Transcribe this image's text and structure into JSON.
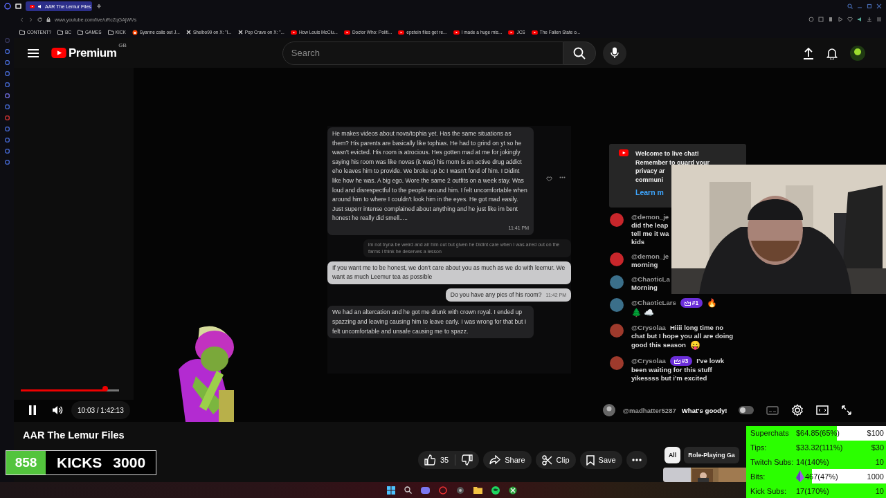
{
  "browser": {
    "tab": {
      "title": "AAR The Lemur Files"
    },
    "address": "www.youtube.com/live/uRcZqGAjWVs",
    "bookmarks": [
      {
        "label": "CONTENT?",
        "kind": "folder"
      },
      {
        "label": "BC",
        "kind": "folder"
      },
      {
        "label": "GAMES",
        "kind": "folder"
      },
      {
        "label": "KICK",
        "kind": "folder"
      },
      {
        "label": "Syanne calls out J...",
        "kind": "reddit"
      },
      {
        "label": "Shelbo99 on X: \"I...",
        "kind": "x"
      },
      {
        "label": "Pop Crave on X: \"...",
        "kind": "x"
      },
      {
        "label": "How Louis McClu...",
        "kind": "youtube"
      },
      {
        "label": "Doctor Who: Politi...",
        "kind": "youtube"
      },
      {
        "label": "epstein files get re...",
        "kind": "youtube"
      },
      {
        "label": "I made a huge mis...",
        "kind": "youtube"
      },
      {
        "label": "JCS",
        "kind": "youtube"
      },
      {
        "label": "The Fallen State o...",
        "kind": "youtube"
      }
    ]
  },
  "header": {
    "logo": "Premium",
    "region": "GB",
    "search": {
      "placeholder": "Search"
    }
  },
  "video": {
    "messages": [
      {
        "kind": "received",
        "text": "He makes videos about nova/tophia yet. Has the same situations as them? His parents are basically like tophias. He had to grind on yt so he wasn't evicted. His room is atrocious. Hes gotten mad at me for jokingly saying his room was like novas (it was) his mom is an active drug addict eho leaves him to provide. We broke up bc I wasn't fond of him. I Didint like how he was. A big ego. Wore the same 2 outfits on a week stay. Was loud and disrespectful to the people around him. I felt uncomfortable when around him to where I couldn't look him in the eyes. He got mad easily. Just superr intense complained about anything and he just like im bent honest he really did smell.....",
        "time": "11:41 PM"
      },
      {
        "kind": "quote",
        "text": "im not tryna be weird and air him out but given he Didint care when I was aired out on the farms i think he deserves a lesson"
      },
      {
        "kind": "sent",
        "text": "If you want me to be honest, we don't care about you as much as we do with leemur. We want as much Leemur tea as possible"
      },
      {
        "kind": "sent",
        "text": "Do you have any pics of his room?",
        "time": "11:42 PM"
      },
      {
        "kind": "received",
        "text": "We had an altercation and he got me drunk with crown royal. I ended up spazzing and leaving causing him to leave early. I was wrong for that but I felt uncomfortable and unsafe causing me to spazz."
      }
    ],
    "progress": {
      "level": 0.86
    },
    "time": "10:03 / 1:42:13"
  },
  "chat": {
    "welcome": {
      "lines": [
        "Welcome to live chat!",
        "Remember to guard your",
        "privacy ar",
        "communi"
      ],
      "link": "Learn m"
    },
    "messages": [
      {
        "author": "@demon_je",
        "color": "#c8262b",
        "inline": false,
        "rows": [
          {
            "text": "did the leap"
          },
          {
            "text": "tell me it wa"
          },
          {
            "text": "kids"
          }
        ]
      },
      {
        "author": "@demon_je",
        "color": "#c8262b",
        "inline": false,
        "rows": [
          {
            "text": "morning"
          }
        ]
      },
      {
        "author": "@ChaoticLa",
        "color": "#3b6f8a",
        "inline": false,
        "rows": [
          {
            "text": "Morning"
          }
        ]
      },
      {
        "author": "@ChaoticLars",
        "color": "#3b6f8a",
        "inline": true,
        "badge": "#1",
        "rows": [
          {
            "emoji": "🔥"
          },
          {
            "emoji": "🌲 ☁️"
          }
        ]
      },
      {
        "author": "@Crysolaa",
        "color": "#9e3a2c",
        "inline": true,
        "rows": [
          {
            "text": "Hiiii long time no"
          },
          {
            "text": "chat but I hope you all are doing"
          },
          {
            "text": "good this season",
            "emoji": "😛"
          }
        ]
      },
      {
        "author": "@Crysolaa",
        "color": "#9e3a2c",
        "inline": true,
        "badge": "#3",
        "rows": [
          {
            "text": "I've lowk"
          },
          {
            "text": "been waiting for this stuff"
          },
          {
            "text": "yikessss but i'm excited"
          }
        ]
      }
    ],
    "footer": {
      "author": "@madhatter5287",
      "text": "What's goody!"
    }
  },
  "title": "AAR The Lemur Files",
  "actions": {
    "likes": "35",
    "buttons": [
      {
        "label": "Share",
        "kind": "share"
      },
      {
        "label": "Clip",
        "kind": "clip"
      },
      {
        "label": "Save",
        "kind": "save"
      }
    ]
  },
  "chips": [
    {
      "label": "All",
      "selected": true
    },
    {
      "label": "Role-Playing Ga",
      "selected": false
    }
  ],
  "kicks": {
    "count": "858",
    "label": "KICKS",
    "goal": "3000"
  },
  "goals": [
    {
      "label": "Superchats",
      "amount": "$64.85(65%)",
      "target": "$100",
      "level": 0.65,
      "gem": false
    },
    {
      "label": "Tips:",
      "amount": "$33.32(111%)",
      "target": "$30",
      "level": 1,
      "gem": false
    },
    {
      "label": "Twitch Subs:",
      "amount": "14(140%)",
      "target": "10",
      "level": 1,
      "gem": false
    },
    {
      "label": "Bits:",
      "amount": "467(47%)",
      "target": "1000",
      "level": 0.47,
      "gem": true
    },
    {
      "label": "Kick Subs:",
      "amount": "17(170%)",
      "target": "10",
      "level": 1,
      "gem": false
    }
  ]
}
